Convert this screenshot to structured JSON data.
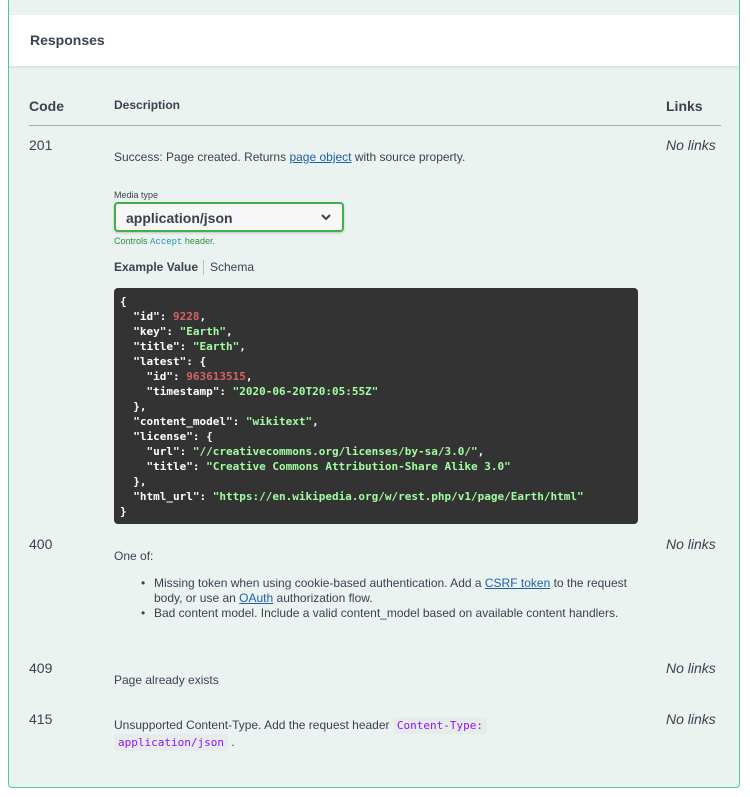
{
  "section": {
    "title": "Responses"
  },
  "table": {
    "headers": {
      "code": "Code",
      "description": "Description",
      "links": "Links"
    }
  },
  "responses": {
    "r201": {
      "code": "201",
      "desc_pre": "Success: Page created. Returns ",
      "desc_link": "page object",
      "desc_post": " with source property.",
      "links": "No links",
      "media_label": "Media type",
      "media_value": "application/json",
      "controls_pre": "Controls ",
      "controls_accept": "Accept",
      "controls_post": " header.",
      "tab_example": "Example Value",
      "tab_schema": "Schema"
    },
    "r400": {
      "code": "400",
      "desc": "One of:",
      "links": "No links",
      "bullet1_pre": "Missing token when using cookie-based authentication. Add a ",
      "bullet1_link1": "CSRF token",
      "bullet1_mid": " to the request body, or use an ",
      "bullet1_link2": "OAuth",
      "bullet1_post": " authorization flow.",
      "bullet2": "Bad content model. Include a valid content_model based on available content handlers."
    },
    "r409": {
      "code": "409",
      "desc": "Page already exists",
      "links": "No links"
    },
    "r415": {
      "code": "415",
      "desc_pre": "Unsupported Content-Type. Add the request header ",
      "desc_code1": "Content-Type:",
      "desc_code2": "application/json",
      "desc_post": " .",
      "links": "No links"
    }
  },
  "example": {
    "id": "9228",
    "key": "\"Earth\"",
    "title": "\"Earth\"",
    "latest_id": "963613515",
    "latest_timestamp": "\"2020-06-20T20:05:55Z\"",
    "content_model": "\"wikitext\"",
    "license_url": "\"//creativecommons.org/licenses/by-sa/3.0/\"",
    "license_title": "\"Creative Commons Attribution-Share Alike 3.0\"",
    "html_url": "\"https://en.wikipedia.org/w/rest.php/v1/page/Earth/html\""
  },
  "colors": {
    "accent": "#49cc90",
    "select_border": "#41b04b",
    "code_bg": "#333333"
  }
}
